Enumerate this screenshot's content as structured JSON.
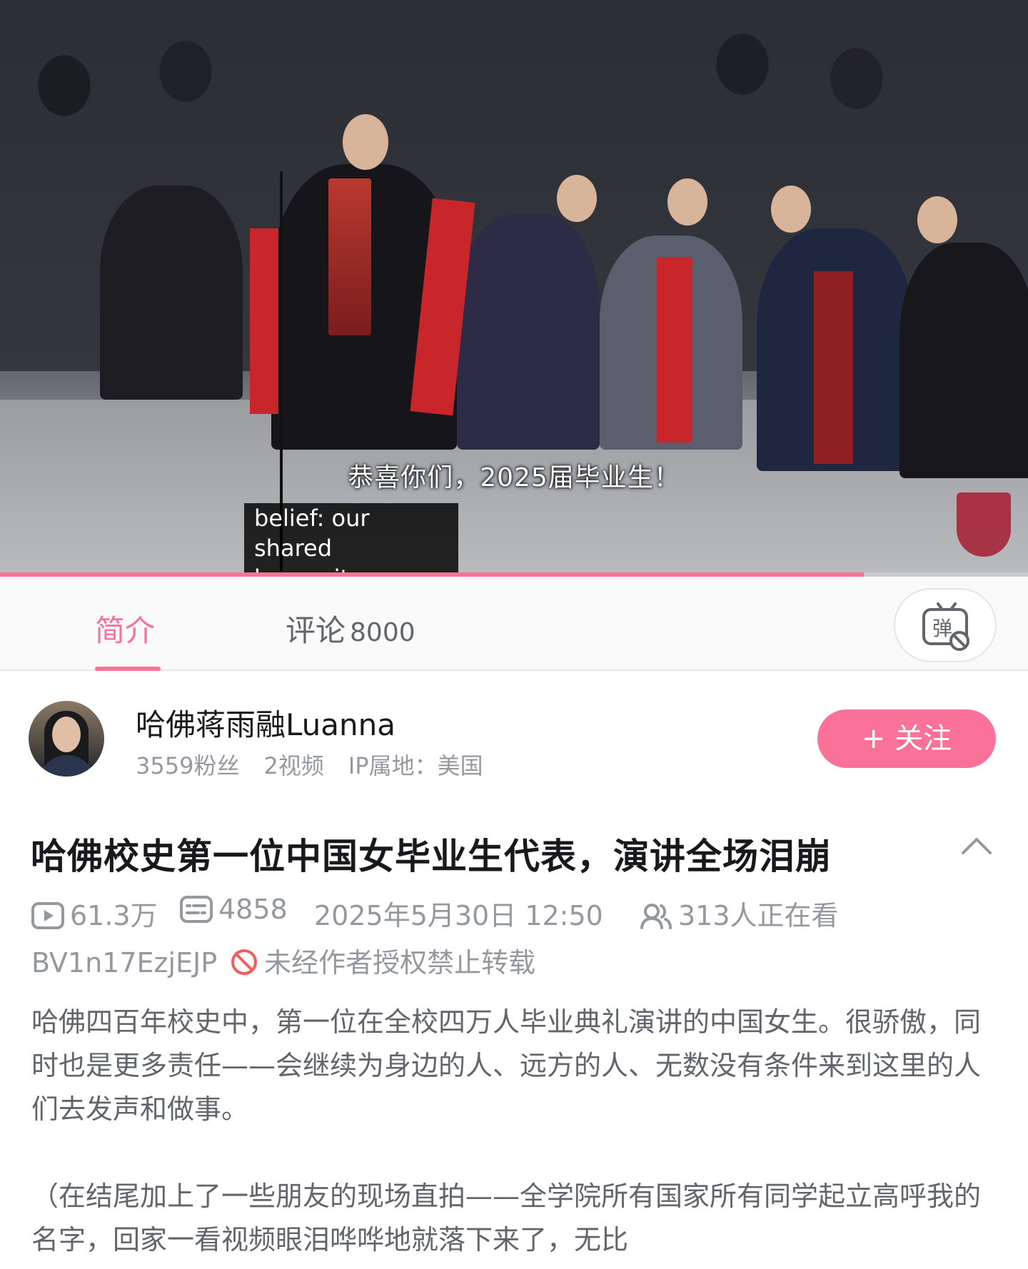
{
  "player": {
    "subtitle_cn": "恭喜你们，2025届毕业生！",
    "subtitle_en": "belief: our shared\nhumanity.",
    "progress": 0.84,
    "accent_color": "#fb7299"
  },
  "tabs": {
    "intro_label": "简介",
    "comments_label": "评论",
    "comments_count": "8000",
    "danmaku_icon": "danmaku-off-icon"
  },
  "uploader": {
    "name": "哈佛蒋雨融Luanna",
    "fans": "3559粉丝",
    "videos": "2视频",
    "ip": "IP属地：美国",
    "follow_label": "+ 关注"
  },
  "video": {
    "title": "哈佛校史第一位中国女毕业生代表，演讲全场泪崩",
    "views": "61.3万",
    "danmaku_count": "4858",
    "publish_time": "2025年5月30日 12:50",
    "watching": "313人正在看",
    "bvid": "BV1n17EzjEJP",
    "copyright_notice": "未经作者授权禁止转载"
  },
  "description": {
    "paragraph1": "哈佛四百年校史中，第一位在全校四万人毕业典礼演讲的中国女生。很骄傲，同时也是更多责任——会继续为身边的人、远方的人、无数没有条件来到这里的人们去发声和做事。",
    "paragraph2": "（在结尾加上了一些朋友的现场直拍——全学院所有国家所有同学起立高呼我的名字，回家一看视频眼泪哗哗地就落下来了，无比"
  }
}
